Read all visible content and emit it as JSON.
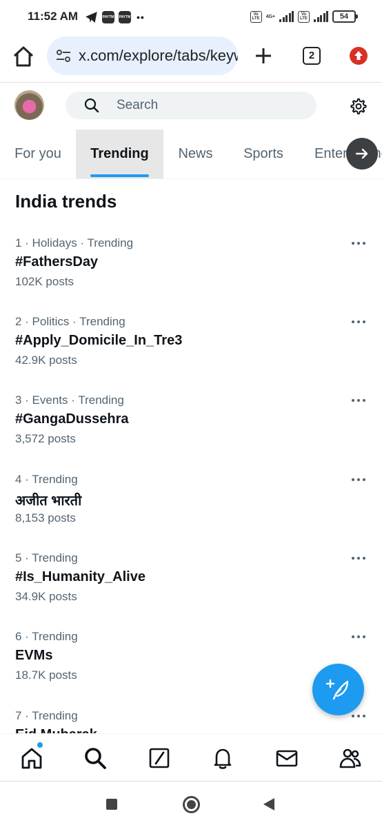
{
  "status_bar": {
    "time": "11:52 AM",
    "paytm_label": "PAYTM",
    "volte_label": "Vo LTE",
    "network_label": "4G+",
    "battery": "54"
  },
  "browser": {
    "url": "x.com/explore/tabs/keyword",
    "tab_count": "2",
    "accent_color": "#d93025"
  },
  "search": {
    "placeholder": "Search"
  },
  "tabs": [
    {
      "label": "For you"
    },
    {
      "label": "Trending"
    },
    {
      "label": "News"
    },
    {
      "label": "Sports"
    },
    {
      "label": "Entertainment"
    }
  ],
  "section_title": "India trends",
  "trends": [
    {
      "meta": "1 · Holidays · Trending",
      "name": "#FathersDay",
      "count": "102K posts"
    },
    {
      "meta": "2 · Politics · Trending",
      "name": "#Apply_Domicile_In_Tre3",
      "count": "42.9K posts"
    },
    {
      "meta": "3 · Events · Trending",
      "name": "#GangaDussehra",
      "count": "3,572 posts"
    },
    {
      "meta": "4 · Trending",
      "name": "अजीत भारती",
      "count": "8,153 posts"
    },
    {
      "meta": "5 · Trending",
      "name": "#Is_Humanity_Alive",
      "count": "34.9K posts"
    },
    {
      "meta": "6 · Trending",
      "name": "EVMs",
      "count": "18.7K posts"
    },
    {
      "meta": "7 · Trending",
      "name": "Eid Mubarak",
      "count": ""
    }
  ],
  "icons": {
    "home": "home-icon",
    "search": "search-icon",
    "grok": "grok-icon",
    "notifications": "bell-icon",
    "messages": "mail-icon",
    "communities": "people-icon",
    "compose": "feather-plus-icon"
  },
  "colors": {
    "brand": "#1d9bf0",
    "text": "#0f1419",
    "secondary": "#536471"
  }
}
